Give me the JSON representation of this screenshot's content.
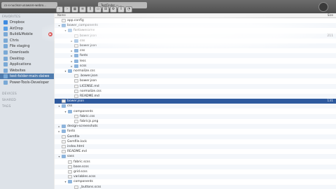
{
  "window": {
    "tab1_title": "cs-s-nuclear-unaware-webro...",
    "tab2_title": "TestFinder — ...",
    "colors": {
      "sidebar": "#dde2e8",
      "selection": "#2e5a9e",
      "titlebar": "#5a5a5a"
    }
  },
  "toolbar": {
    "buttons": [
      {
        "icon": "back-icon",
        "glyph": "‹"
      },
      {
        "icon": "forward-icon",
        "glyph": "›"
      },
      {
        "icon": "icon-view-icon",
        "glyph": "▦"
      },
      {
        "icon": "list-view-icon",
        "glyph": "≡"
      },
      {
        "icon": "column-view-icon",
        "glyph": "⫼"
      },
      {
        "icon": "coverflow-icon",
        "glyph": "▭"
      },
      {
        "icon": "arrange-icon",
        "glyph": "⊞"
      },
      {
        "icon": "action-gear-icon",
        "glyph": "⚙"
      },
      {
        "icon": "share-icon",
        "glyph": "⇪"
      },
      {
        "icon": "tags-icon",
        "glyph": "◔"
      }
    ]
  },
  "sidebar": {
    "favorites_heading": "FAVORITES",
    "devices_heading": "DEVICES",
    "shared_heading": "SHARED",
    "tags_heading": "TAGS",
    "items": [
      {
        "label": "Dropbox",
        "icon": "dropbox-icon",
        "color": "#3d8ae0"
      },
      {
        "label": "AirDrop",
        "icon": "airdrop-icon",
        "color": "#5aa0e6"
      },
      {
        "label": "Build&Mobile",
        "icon": "folder-icon",
        "color": "#7aa9d6"
      },
      {
        "label": "Chris",
        "icon": "home-icon",
        "color": "#7aa9d6"
      },
      {
        "label": "File staging",
        "icon": "folder-icon",
        "color": "#7aa9d6"
      },
      {
        "label": "Downloads",
        "icon": "downloads-icon",
        "color": "#7aa9d6"
      },
      {
        "label": "Desktop",
        "icon": "desktop-icon",
        "color": "#7aa9d6"
      },
      {
        "label": "Applications",
        "icon": "applications-icon",
        "color": "#7aa9d6"
      },
      {
        "label": "Websites",
        "icon": "folder-icon",
        "color": "#7aa9d6"
      },
      {
        "label": "test-folder-main-daiwe",
        "icon": "folder-icon",
        "color": "#7aa9d6"
      },
      {
        "label": "Power-Tools-Developer",
        "icon": "folder-icon",
        "color": "#7aa9d6"
      }
    ]
  },
  "file_list": {
    "col_name": "Name",
    "col_size": "Size",
    "rows": [
      {
        "name": "app.config",
        "size": "",
        "depth": 0,
        "disclosure": "",
        "kind": "file"
      },
      {
        "name": "bower_components",
        "size": "",
        "depth": 0,
        "disclosure": "▾",
        "kind": "folder"
      },
      {
        "name": "fontawesome",
        "size": "",
        "depth": 1,
        "disclosure": "▾",
        "kind": "folder"
      },
      {
        "name": "bower.json",
        "size": "211",
        "depth": 2,
        "disclosure": "",
        "kind": "file"
      },
      {
        "name": "css",
        "size": "",
        "depth": 2,
        "disclosure": "▸",
        "kind": "folder"
      },
      {
        "name": "bower.json",
        "size": "",
        "depth": 2,
        "disclosure": "",
        "kind": "file"
      },
      {
        "name": "css",
        "size": "",
        "depth": 2,
        "disclosure": "▸",
        "kind": "folder"
      },
      {
        "name": "fonts",
        "size": "",
        "depth": 2,
        "disclosure": "▸",
        "kind": "folder"
      },
      {
        "name": "less",
        "size": "",
        "depth": 2,
        "disclosure": "▸",
        "kind": "folder"
      },
      {
        "name": "scss",
        "size": "",
        "depth": 2,
        "disclosure": "▸",
        "kind": "folder"
      },
      {
        "name": "normalize.css",
        "size": "",
        "depth": 1,
        "disclosure": "▾",
        "kind": "folder"
      },
      {
        "name": ".bower.json",
        "size": "",
        "depth": 2,
        "disclosure": "",
        "kind": "file"
      },
      {
        "name": "bower.json",
        "size": "",
        "depth": 2,
        "disclosure": "",
        "kind": "file"
      },
      {
        "name": "LICENSE.md",
        "size": "",
        "depth": 2,
        "disclosure": "",
        "kind": "file"
      },
      {
        "name": "normalize.css",
        "size": "",
        "depth": 2,
        "disclosure": "",
        "kind": "file"
      },
      {
        "name": "README.md",
        "size": "",
        "depth": 2,
        "disclosure": "",
        "kind": "file"
      },
      {
        "name": "bower.json",
        "size": "131",
        "depth": 0,
        "disclosure": "",
        "kind": "file",
        "selected": true
      },
      {
        "name": "css",
        "size": "",
        "depth": 0,
        "disclosure": "▾",
        "kind": "folder"
      },
      {
        "name": "components",
        "size": "",
        "depth": 1,
        "disclosure": "▾",
        "kind": "folder"
      },
      {
        "name": "fabric.css",
        "size": "",
        "depth": 2,
        "disclosure": "",
        "kind": "file"
      },
      {
        "name": "fabricjs.png",
        "size": "",
        "depth": 2,
        "disclosure": "",
        "kind": "file"
      },
      {
        "name": "design-screenshots",
        "size": "",
        "depth": 0,
        "disclosure": "▸",
        "kind": "folder"
      },
      {
        "name": "fonts",
        "size": "",
        "depth": 0,
        "disclosure": "▸",
        "kind": "folder"
      },
      {
        "name": "Gemfile",
        "size": "",
        "depth": 0,
        "disclosure": "",
        "kind": "file"
      },
      {
        "name": "Gemfile.lock",
        "size": "",
        "depth": 0,
        "disclosure": "",
        "kind": "file"
      },
      {
        "name": "index.html",
        "size": "",
        "depth": 0,
        "disclosure": "",
        "kind": "file"
      },
      {
        "name": "README.md",
        "size": "",
        "depth": 0,
        "disclosure": "",
        "kind": "file"
      },
      {
        "name": "sass",
        "size": "",
        "depth": 0,
        "disclosure": "▾",
        "kind": "folder"
      },
      {
        "name": "fabric.scss",
        "size": "",
        "depth": 1,
        "disclosure": "",
        "kind": "file"
      },
      {
        "name": "base.scss",
        "size": "",
        "depth": 1,
        "disclosure": "",
        "kind": "file"
      },
      {
        "name": "grid.scss",
        "size": "",
        "depth": 1,
        "disclosure": "",
        "kind": "file"
      },
      {
        "name": "variables.scss",
        "size": "",
        "depth": 1,
        "disclosure": "",
        "kind": "file"
      },
      {
        "name": "components",
        "size": "",
        "depth": 1,
        "disclosure": "▾",
        "kind": "folder"
      },
      {
        "name": "_buttons.scss",
        "size": "",
        "depth": 2,
        "disclosure": "",
        "kind": "file"
      }
    ]
  }
}
